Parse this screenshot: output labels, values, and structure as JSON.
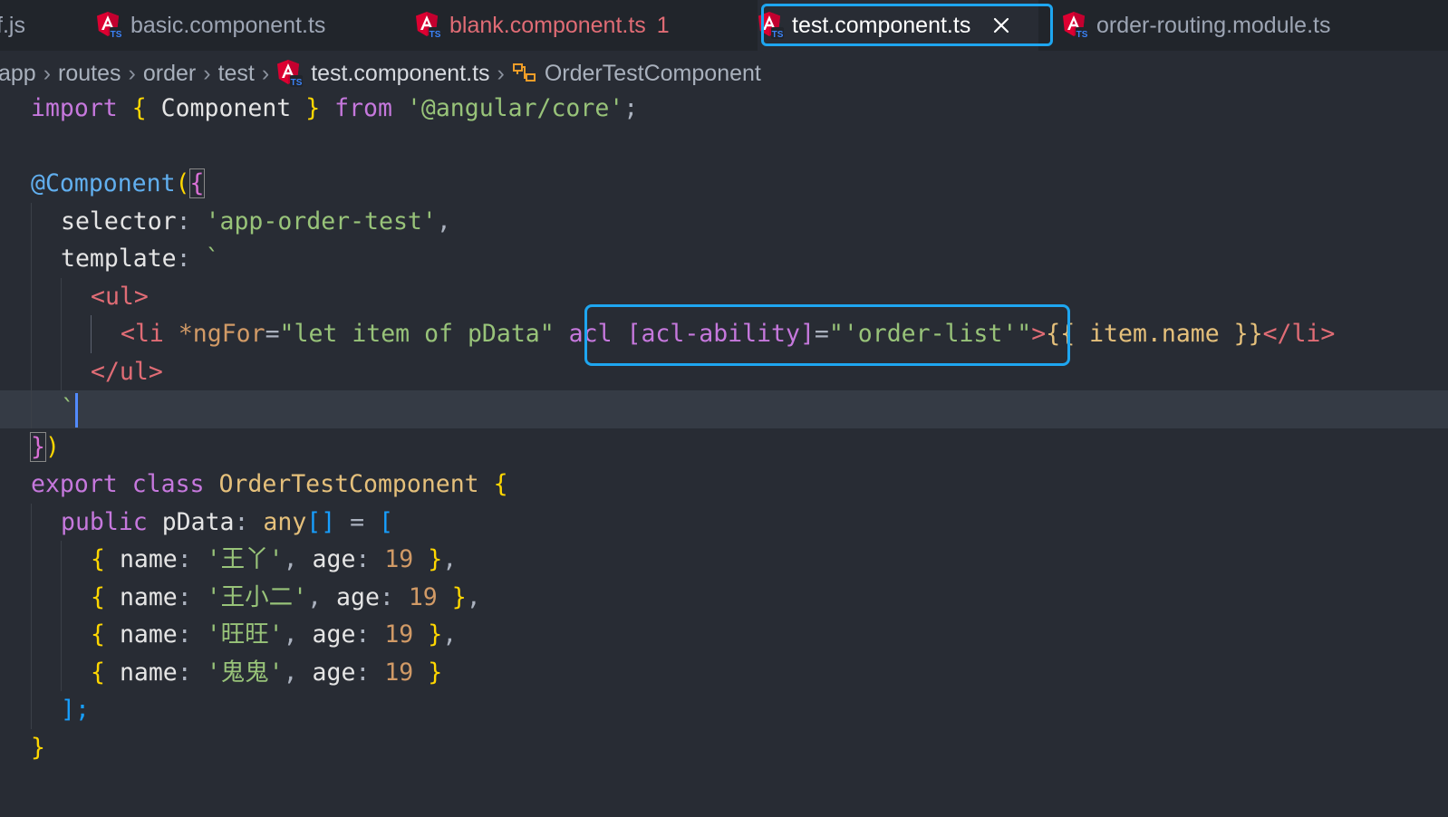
{
  "tabs": [
    {
      "label": "f.js",
      "state": "normal"
    },
    {
      "label": "basic.component.ts",
      "state": "normal"
    },
    {
      "label": "blank.component.ts",
      "badge": "1",
      "state": "modified"
    },
    {
      "label": "test.component.ts",
      "state": "active",
      "close_icon": "close-icon"
    },
    {
      "label": "order-routing.module.ts",
      "state": "normal"
    }
  ],
  "breadcrumb": {
    "items": [
      "app",
      "routes",
      "order",
      "test"
    ],
    "file": "test.component.ts",
    "symbol": "OrderTestComponent",
    "symbol_icon": "class-symbol-icon"
  },
  "code": {
    "line1": [
      "import",
      "{",
      "Component",
      "}",
      "from",
      "'@angular/core'",
      ";"
    ],
    "decorator": "@Component",
    "selector_key": "selector",
    "selector_val": "'app-order-test'",
    "template_key": "template",
    "backtick": "`",
    "ul_open": "<ul>",
    "li_open": "<li",
    "ngfor_attr": "*ngFor",
    "ngfor_val": "\"let item of pData\"",
    "acl_attr": "acl",
    "acl_ability_attr": "[acl-ability]",
    "acl_ability_val": "\"'order-list'\"",
    "interp": "{{ item.name }}",
    "li_close": "</li>",
    "ul_close": "</ul>",
    "close_decorator": "})",
    "class_kw": [
      "export",
      "class"
    ],
    "class_name": "OrderTestComponent",
    "field": [
      "public",
      "pData",
      "any"
    ],
    "data_rows": [
      {
        "name": "'王丫'",
        "age": "19",
        "trail": ","
      },
      {
        "name": "'王小二'",
        "age": "19",
        "trail": ","
      },
      {
        "name": "'旺旺'",
        "age": "19",
        "trail": ","
      },
      {
        "name": "'鬼鬼'",
        "age": "19",
        "trail": ""
      }
    ],
    "array_close": "];",
    "class_close": "}"
  },
  "colors": {
    "editor_bg": "#282c34",
    "tabbar_bg": "#21252b",
    "highlight": "#1ea6f0",
    "angular_red": "#dd0031"
  }
}
